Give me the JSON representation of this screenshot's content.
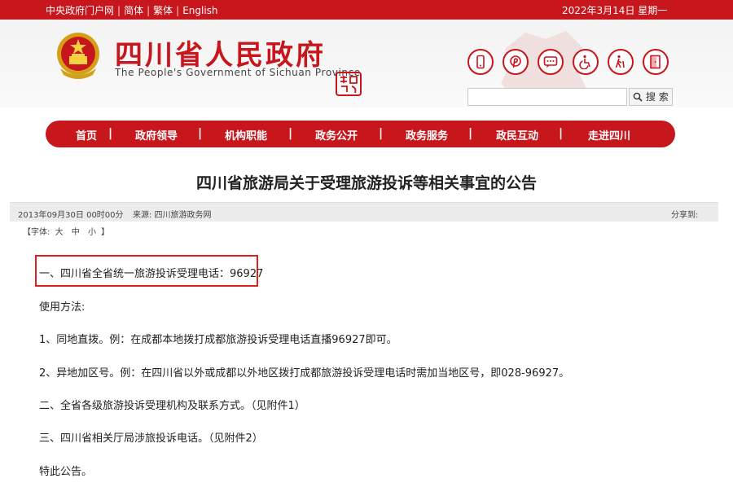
{
  "topbar": {
    "links": [
      "中央政府门户网",
      "简体",
      "繁体",
      "English"
    ],
    "date": "2022年3月14日 星期一"
  },
  "header": {
    "title": "四川省人民政府",
    "subtitle": "The People's Government of Sichuan Province",
    "icons": [
      "mobile-icon",
      "pinterest-icon",
      "message-icon",
      "wheelchair-icon",
      "elder-care-icon",
      "exit-door-icon"
    ],
    "search": {
      "placeholder": "",
      "button_label": "搜 索"
    }
  },
  "nav": {
    "items": [
      "首页",
      "政府领导",
      "机构职能",
      "政务公开",
      "政务服务",
      "政民互动",
      "走进四川"
    ]
  },
  "article": {
    "title": "四川省旅游局关于受理旅游投诉等相关事宜的公告",
    "date": "2013年09月30日 00时00分",
    "source": "来源: 四川旅游政务网",
    "share": "分享到:",
    "font_size": {
      "label": "【字体:",
      "large": "大",
      "medium": "中",
      "small": "小",
      "close": "】"
    },
    "paragraphs": [
      "一、四川省全省统一旅游投诉受理电话：96927",
      "使用方法:",
      "1、同地直拨。例：在成都本地拨打成都旅游投诉受理电话直播96927即可。",
      "2、异地加区号。例：在四川省以外或成都以外地区拨打成都旅游投诉受理电话时需加当地区号，即028-96927。",
      "二、全省各级旅游投诉受理机构及联系方式。（见附件1）",
      "三、四川省相关厅局涉旅投诉电话。（见附件2）",
      "特此公告。"
    ]
  },
  "colors": {
    "brand_red": "#c8161d",
    "highlight_red": "#e0201c"
  }
}
